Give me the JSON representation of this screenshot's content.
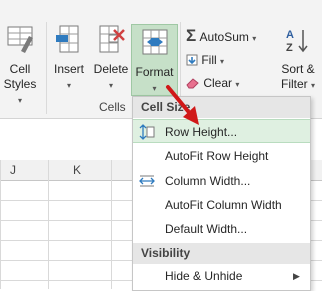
{
  "ribbon": {
    "cell_styles": {
      "line1": "Cell",
      "line2": "Styles"
    },
    "insert_label": "Insert",
    "delete_label": "Delete",
    "format_label": "Format",
    "cells_group_label": "Cells",
    "autosum_label": "AutoSum",
    "fill_label": "Fill",
    "clear_label": "Clear",
    "sort_filter": {
      "line1": "Sort &",
      "line2": "Filter"
    }
  },
  "columns": [
    "J",
    "K"
  ],
  "menu": {
    "cell_size_header": "Cell Size",
    "items": [
      {
        "label": "Row Height...",
        "highlighted": true,
        "icon": "row-height-icon"
      },
      {
        "label": "AutoFit Row Height"
      },
      {
        "label": "Column Width...",
        "icon": "column-width-icon"
      },
      {
        "label": "AutoFit Column Width"
      },
      {
        "label": "Default Width..."
      }
    ],
    "visibility_header": "Visibility",
    "hide_unhide_label": "Hide & Unhide"
  },
  "colors": {
    "ribbon_bg": "#f3f3f3",
    "format_active_bg": "#c6e0c8",
    "menu_highlight": "#dff0e1",
    "arrow": "#d01818"
  }
}
